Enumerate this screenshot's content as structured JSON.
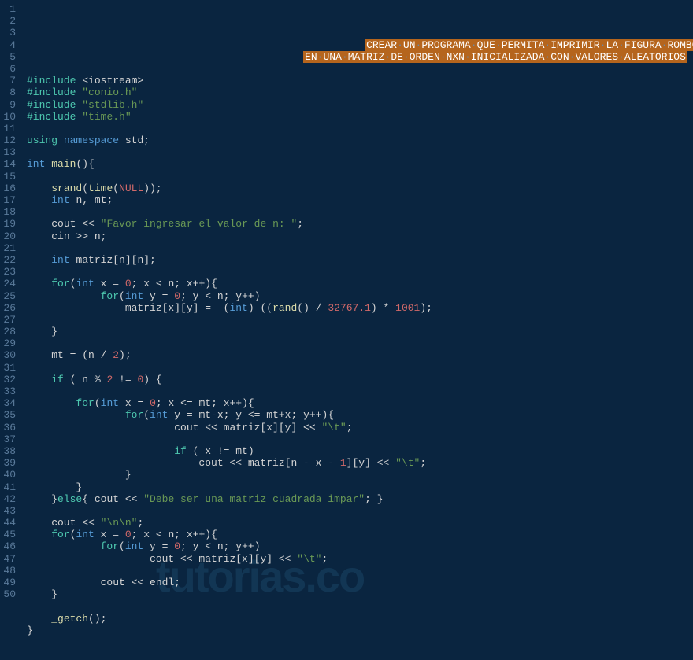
{
  "watermark": "tutorias.co",
  "line_count": 50,
  "comment_line1": "CREAR·UN·PROGRAMA·QUE·PERMITA·IMPRIMIR·LA·FIGURA·ROMBO",
  "comment_line2": "EN·UNA·MATRIZ·DE·ORDEN·NXN·INICIALIZADA·CON·VALORES·ALEATORIOS",
  "tokens": {
    "include": "#include",
    "iostream": "<iostream>",
    "conio": "\"conio.h\"",
    "stdlib": "\"stdlib.h\"",
    "timeh": "\"time.h\"",
    "using": "using",
    "namespace": "namespace",
    "std": "std",
    "int": "int",
    "main": "main",
    "srand": "srand",
    "time": "time",
    "null": "NULL",
    "n_mt": "n, mt;",
    "cout": "cout",
    "cin": "cin",
    "str_favor": "\"Favor ingresar el valor de n: \"",
    "matriz_decl": "matriz[n][n];",
    "for": "for",
    "zero": "0",
    "two": "2",
    "one": "1",
    "rand": "rand",
    "divisor": "32767.1",
    "mult": "1001",
    "tab": "\"\\t\"",
    "str_debe": "\"Debe ser una matriz cuadrada impar\"",
    "str_nn": "\"\\n\\n\"",
    "endl": "endl",
    "getch": "_getch",
    "if": "if",
    "else": "else"
  }
}
